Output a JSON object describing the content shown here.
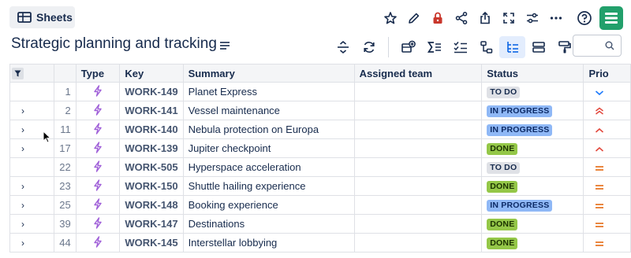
{
  "topbar": {
    "sheets_label": "Sheets",
    "icons": [
      "star-icon",
      "edit-icon",
      "lock-icon",
      "share-icon",
      "export-icon",
      "fullscreen-icon",
      "settings-icon",
      "more-icon",
      "help-icon",
      "app-logo-icon"
    ]
  },
  "title": "Strategic planning and tracking",
  "toolbar": {
    "tools": [
      "collapse-rows-icon",
      "refresh-icon",
      "add-view-icon",
      "sum-icon",
      "checklist-icon",
      "hierarchy-icon",
      "tree-icon",
      "rows-icon",
      "paint-format-icon"
    ],
    "active_tool": "tree-icon",
    "search_placeholder": ""
  },
  "table": {
    "headers": {
      "type": "Type",
      "key": "Key",
      "summary": "Summary",
      "team": "Assigned team",
      "status": "Status",
      "priority": "Prio"
    },
    "rows": [
      {
        "num": "1",
        "expandable": false,
        "key": "WORK-149",
        "summary": "Planet Express",
        "team": "",
        "status": "TO DO",
        "status_kind": "todo",
        "priority": "low"
      },
      {
        "num": "2",
        "expandable": true,
        "key": "WORK-141",
        "summary": "Vessel maintenance",
        "team": "",
        "status": "IN PROGRESS",
        "status_kind": "prog",
        "priority": "highest"
      },
      {
        "num": "11",
        "expandable": true,
        "key": "WORK-140",
        "summary": "Nebula protection on Europa",
        "team": "",
        "status": "IN PROGRESS",
        "status_kind": "prog",
        "priority": "high"
      },
      {
        "num": "17",
        "expandable": true,
        "key": "WORK-139",
        "summary": "Jupiter checkpoint",
        "team": "",
        "status": "DONE",
        "status_kind": "done",
        "priority": "high"
      },
      {
        "num": "22",
        "expandable": false,
        "key": "WORK-505",
        "summary": "Hyperspace acceleration",
        "team": "",
        "status": "TO DO",
        "status_kind": "todo",
        "priority": "medium"
      },
      {
        "num": "23",
        "expandable": true,
        "key": "WORK-150",
        "summary": "Shuttle hailing experience",
        "team": "",
        "status": "DONE",
        "status_kind": "done",
        "priority": "medium"
      },
      {
        "num": "25",
        "expandable": true,
        "key": "WORK-148",
        "summary": "Booking experience",
        "team": "",
        "status": "IN PROGRESS",
        "status_kind": "prog",
        "priority": "medium"
      },
      {
        "num": "39",
        "expandable": true,
        "key": "WORK-147",
        "summary": "Destinations",
        "team": "",
        "status": "DONE",
        "status_kind": "done",
        "priority": "medium"
      },
      {
        "num": "44",
        "expandable": true,
        "key": "WORK-145",
        "summary": "Interstellar lobbying",
        "team": "",
        "status": "DONE",
        "status_kind": "done",
        "priority": "medium"
      }
    ]
  },
  "colors": {
    "accent": "#0c66e4",
    "logo": "#22a06b",
    "lock": "#c9372c",
    "type_icon": "#9f5fd8",
    "prio_low": "#1d7afc",
    "prio_high": "#e2483d",
    "prio_medium": "#e56910"
  }
}
